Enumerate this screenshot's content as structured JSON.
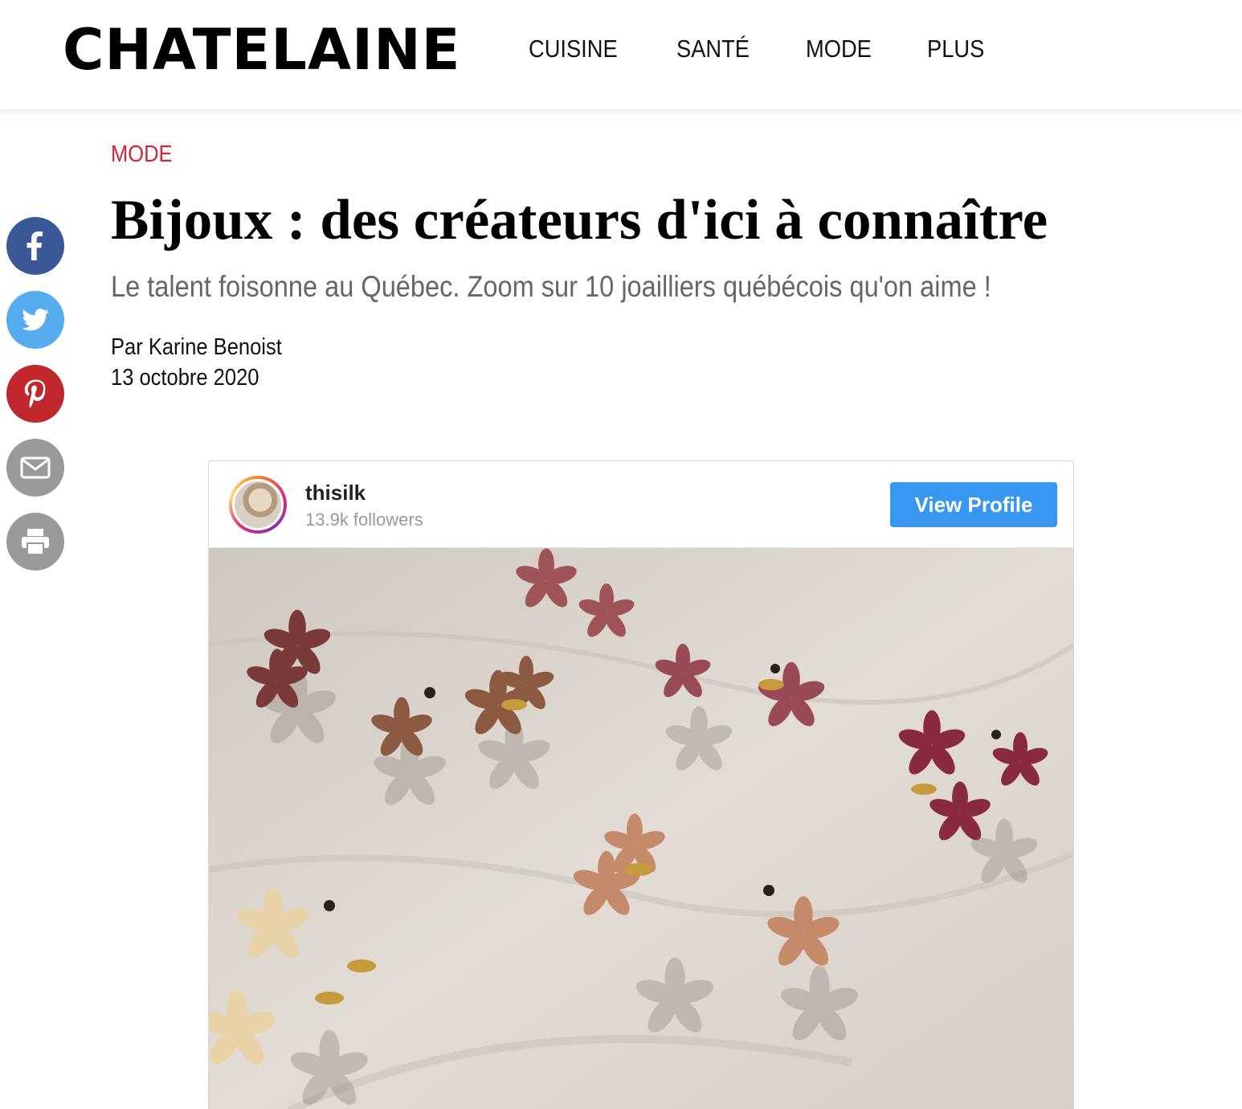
{
  "site": {
    "logo": "CHATELAINE",
    "nav": [
      "CUISINE",
      "SANTÉ",
      "MODE",
      "PLUS"
    ]
  },
  "share": {
    "icons": [
      "facebook-icon",
      "twitter-icon",
      "pinterest-icon",
      "email-icon",
      "print-icon"
    ],
    "colors": {
      "facebook": "#3b5998",
      "twitter": "#55acee",
      "pinterest": "#c0282d",
      "email": "#9a9a9a",
      "print": "#9a9a9a"
    }
  },
  "article": {
    "category": "MODE",
    "title": "Bijoux : des créateurs d'ici à connaître",
    "dek": "Le talent foisonne au Québec. Zoom sur 10 joailliers québécois qu'on aime !",
    "byline_prefix": "Par",
    "author": "Karine Benoist",
    "date": "13 octobre 2020"
  },
  "embed": {
    "username": "thisilk",
    "followers": "13.9k followers",
    "button_label": "View Profile"
  },
  "colors": {
    "category_red": "#d0263a",
    "instagram_blue": "#3897f0"
  }
}
